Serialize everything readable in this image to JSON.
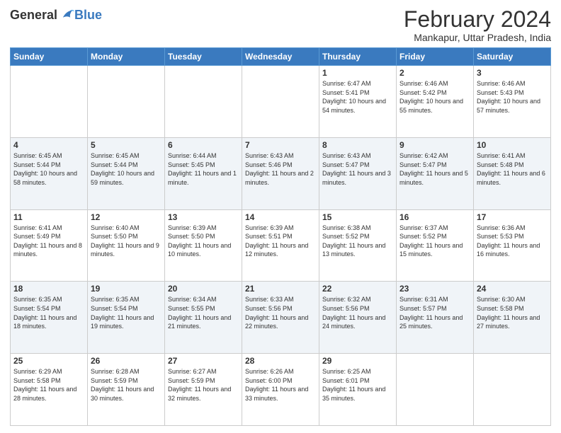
{
  "logo": {
    "general": "General",
    "blue": "Blue"
  },
  "title": "February 2024",
  "subtitle": "Mankapur, Uttar Pradesh, India",
  "days_of_week": [
    "Sunday",
    "Monday",
    "Tuesday",
    "Wednesday",
    "Thursday",
    "Friday",
    "Saturday"
  ],
  "weeks": [
    [
      {
        "day": "",
        "info": ""
      },
      {
        "day": "",
        "info": ""
      },
      {
        "day": "",
        "info": ""
      },
      {
        "day": "",
        "info": ""
      },
      {
        "day": "1",
        "info": "Sunrise: 6:47 AM\nSunset: 5:41 PM\nDaylight: 10 hours and 54 minutes."
      },
      {
        "day": "2",
        "info": "Sunrise: 6:46 AM\nSunset: 5:42 PM\nDaylight: 10 hours and 55 minutes."
      },
      {
        "day": "3",
        "info": "Sunrise: 6:46 AM\nSunset: 5:43 PM\nDaylight: 10 hours and 57 minutes."
      }
    ],
    [
      {
        "day": "4",
        "info": "Sunrise: 6:45 AM\nSunset: 5:44 PM\nDaylight: 10 hours and 58 minutes."
      },
      {
        "day": "5",
        "info": "Sunrise: 6:45 AM\nSunset: 5:44 PM\nDaylight: 10 hours and 59 minutes."
      },
      {
        "day": "6",
        "info": "Sunrise: 6:44 AM\nSunset: 5:45 PM\nDaylight: 11 hours and 1 minute."
      },
      {
        "day": "7",
        "info": "Sunrise: 6:43 AM\nSunset: 5:46 PM\nDaylight: 11 hours and 2 minutes."
      },
      {
        "day": "8",
        "info": "Sunrise: 6:43 AM\nSunset: 5:47 PM\nDaylight: 11 hours and 3 minutes."
      },
      {
        "day": "9",
        "info": "Sunrise: 6:42 AM\nSunset: 5:47 PM\nDaylight: 11 hours and 5 minutes."
      },
      {
        "day": "10",
        "info": "Sunrise: 6:41 AM\nSunset: 5:48 PM\nDaylight: 11 hours and 6 minutes."
      }
    ],
    [
      {
        "day": "11",
        "info": "Sunrise: 6:41 AM\nSunset: 5:49 PM\nDaylight: 11 hours and 8 minutes."
      },
      {
        "day": "12",
        "info": "Sunrise: 6:40 AM\nSunset: 5:50 PM\nDaylight: 11 hours and 9 minutes."
      },
      {
        "day": "13",
        "info": "Sunrise: 6:39 AM\nSunset: 5:50 PM\nDaylight: 11 hours and 10 minutes."
      },
      {
        "day": "14",
        "info": "Sunrise: 6:39 AM\nSunset: 5:51 PM\nDaylight: 11 hours and 12 minutes."
      },
      {
        "day": "15",
        "info": "Sunrise: 6:38 AM\nSunset: 5:52 PM\nDaylight: 11 hours and 13 minutes."
      },
      {
        "day": "16",
        "info": "Sunrise: 6:37 AM\nSunset: 5:52 PM\nDaylight: 11 hours and 15 minutes."
      },
      {
        "day": "17",
        "info": "Sunrise: 6:36 AM\nSunset: 5:53 PM\nDaylight: 11 hours and 16 minutes."
      }
    ],
    [
      {
        "day": "18",
        "info": "Sunrise: 6:35 AM\nSunset: 5:54 PM\nDaylight: 11 hours and 18 minutes."
      },
      {
        "day": "19",
        "info": "Sunrise: 6:35 AM\nSunset: 5:54 PM\nDaylight: 11 hours and 19 minutes."
      },
      {
        "day": "20",
        "info": "Sunrise: 6:34 AM\nSunset: 5:55 PM\nDaylight: 11 hours and 21 minutes."
      },
      {
        "day": "21",
        "info": "Sunrise: 6:33 AM\nSunset: 5:56 PM\nDaylight: 11 hours and 22 minutes."
      },
      {
        "day": "22",
        "info": "Sunrise: 6:32 AM\nSunset: 5:56 PM\nDaylight: 11 hours and 24 minutes."
      },
      {
        "day": "23",
        "info": "Sunrise: 6:31 AM\nSunset: 5:57 PM\nDaylight: 11 hours and 25 minutes."
      },
      {
        "day": "24",
        "info": "Sunrise: 6:30 AM\nSunset: 5:58 PM\nDaylight: 11 hours and 27 minutes."
      }
    ],
    [
      {
        "day": "25",
        "info": "Sunrise: 6:29 AM\nSunset: 5:58 PM\nDaylight: 11 hours and 28 minutes."
      },
      {
        "day": "26",
        "info": "Sunrise: 6:28 AM\nSunset: 5:59 PM\nDaylight: 11 hours and 30 minutes."
      },
      {
        "day": "27",
        "info": "Sunrise: 6:27 AM\nSunset: 5:59 PM\nDaylight: 11 hours and 32 minutes."
      },
      {
        "day": "28",
        "info": "Sunrise: 6:26 AM\nSunset: 6:00 PM\nDaylight: 11 hours and 33 minutes."
      },
      {
        "day": "29",
        "info": "Sunrise: 6:25 AM\nSunset: 6:01 PM\nDaylight: 11 hours and 35 minutes."
      },
      {
        "day": "",
        "info": ""
      },
      {
        "day": "",
        "info": ""
      }
    ]
  ]
}
